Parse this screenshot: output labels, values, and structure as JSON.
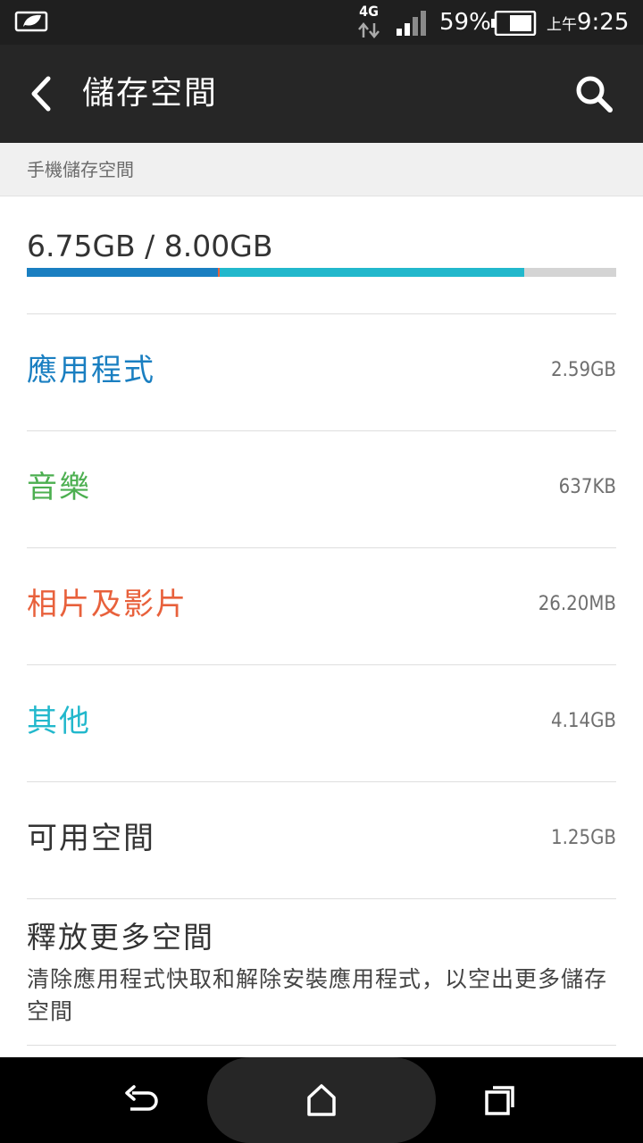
{
  "status_bar": {
    "network_type": "4G",
    "battery_percent": "59%",
    "time_ampm": "上午",
    "time": "9:25",
    "icons": [
      "leaf-icon",
      "data-arrows-icon",
      "signal-icon",
      "battery-icon"
    ]
  },
  "app_bar": {
    "title": "儲存空間",
    "icons": [
      "back-icon",
      "search-icon"
    ]
  },
  "section_header": "手機儲存空間",
  "usage": {
    "text": "6.75GB / 8.00GB",
    "segments": [
      {
        "name": "應用程式",
        "gb": 2.59,
        "color": "#1a7fc1"
      },
      {
        "name": "相片及影片",
        "gb": 0.0262,
        "color": "#e8613c"
      },
      {
        "name": "其他",
        "gb": 4.14,
        "color": "#22b8cc"
      }
    ],
    "total_gb": 8.0,
    "track_color": "#d4d4d4"
  },
  "items": [
    {
      "label": "應用程式",
      "value": "2.59GB",
      "color": "#1a7fc1"
    },
    {
      "label": "音樂",
      "value": "637KB",
      "color": "#4caf50"
    },
    {
      "label": "相片及影片",
      "value": "26.20MB",
      "color": "#e8613c"
    },
    {
      "label": "其他",
      "value": "4.14GB",
      "color": "#22b8cc"
    },
    {
      "label": "可用空間",
      "value": "1.25GB",
      "color": "#333333"
    }
  ],
  "free_more": {
    "title": "釋放更多空間",
    "description": "清除應用程式快取和解除安裝應用程式，以空出更多儲存空間"
  },
  "nav_bar": {
    "icons": [
      "back-nav-icon",
      "home-nav-icon",
      "recents-nav-icon"
    ]
  }
}
